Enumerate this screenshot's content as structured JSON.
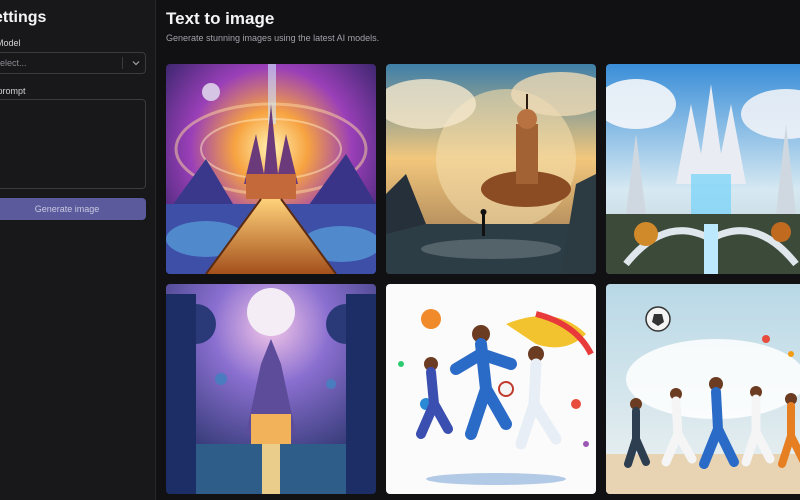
{
  "sidebar": {
    "title": "ettings",
    "model_label": "Model",
    "model_select": {
      "value": "elect..."
    },
    "prompt_label": "r prompt",
    "generate_label": "Generate image"
  },
  "main": {
    "title": "Text to image",
    "subtitle": "Generate stunning images using the latest AI models."
  },
  "colors": {
    "accent_button": "#5b5a9c",
    "background": "#111113",
    "sidebar": "#18181b"
  },
  "gallery": {
    "images": [
      {
        "kind": "fantasy-castle-bridge"
      },
      {
        "kind": "steampunk-airship-cliff"
      },
      {
        "kind": "crystal-city-waterfall"
      },
      {
        "kind": "moon-temple-night"
      },
      {
        "kind": "athletes-running-colorful"
      },
      {
        "kind": "soccer-players-running"
      }
    ]
  }
}
